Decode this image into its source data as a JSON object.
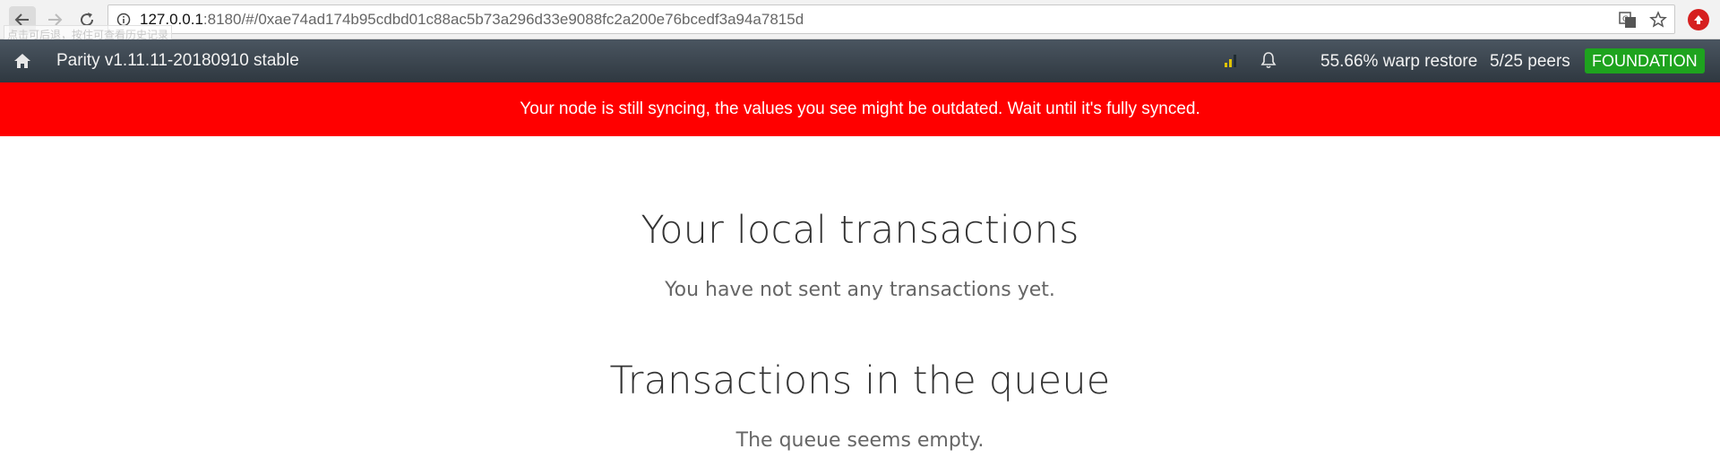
{
  "browser": {
    "tooltip_ghost": "点击可后退，按住可查看历史记录",
    "url_host": "127.0.0.1",
    "url_path": ":8180/#/0xae74ad174b95cdbd01c88ac5b73a296d33e9088fc2a200e76bcedf3a94a7815d",
    "icons": [
      "back-arrow-icon",
      "forward-arrow-icon",
      "reload-icon",
      "info-icon",
      "translate-icon",
      "star-icon",
      "extension-icon"
    ]
  },
  "navbar": {
    "title": "Parity v1.11.11-20180910 stable",
    "sync_status": "55.66% warp restore",
    "peers": "5/25 peers",
    "chain": "FOUNDATION",
    "chain_color": "#1ea31e",
    "icons": [
      "home-icon",
      "signal-icon",
      "bell-icon"
    ]
  },
  "banner": {
    "message": "Your node is still syncing, the values you see might be outdated. Wait until it's fully synced.",
    "color": "#ff0000"
  },
  "main": {
    "local_heading": "Your local transactions",
    "local_text": "You have not sent any transactions yet.",
    "queue_heading": "Transactions in the queue",
    "queue_text": "The queue seems empty."
  }
}
